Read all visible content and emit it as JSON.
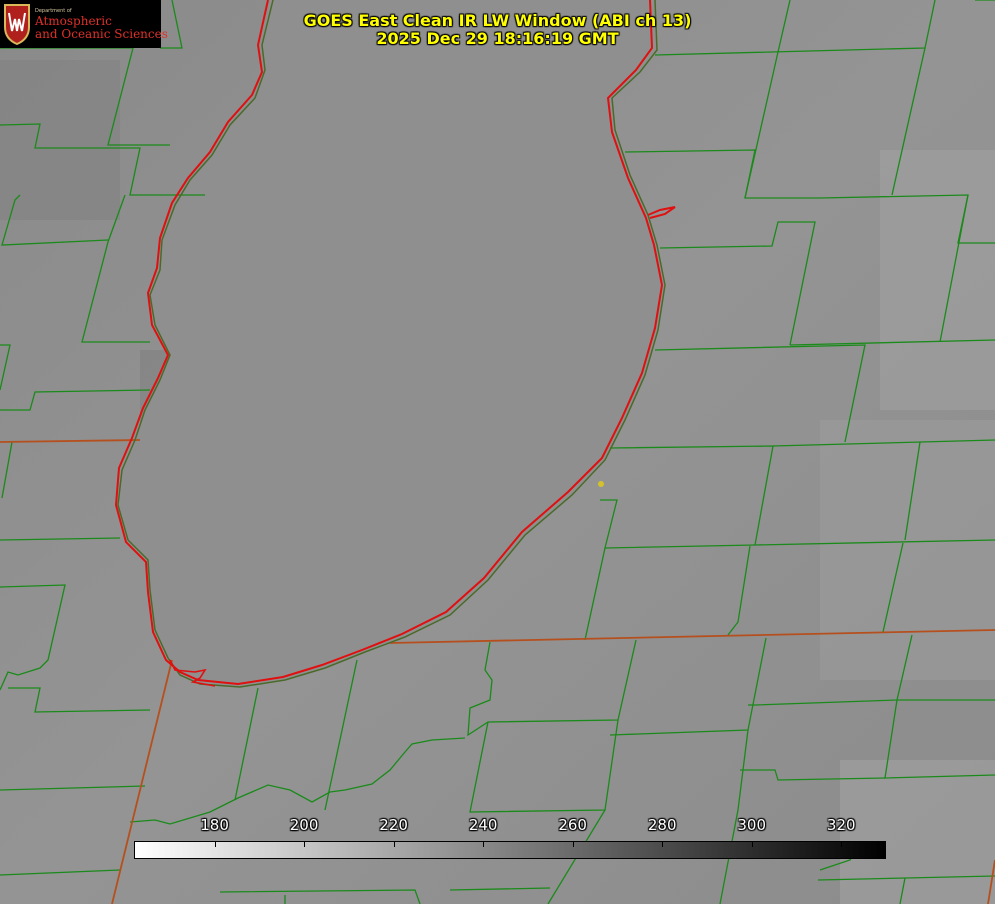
{
  "title": {
    "line1": "GOES East Clean IR LW Window (ABI ch 13)",
    "line2": "2025 Dec 29 18:16:19 GMT"
  },
  "logo": {
    "department": "Department of",
    "line1": "Atmospheric",
    "line2": "and Oceanic Sciences",
    "icon": "uw-crest-icon"
  },
  "colorbar": {
    "min": 162,
    "max": 330,
    "ticks": [
      "180",
      "200",
      "220",
      "240",
      "260",
      "280",
      "300",
      "320"
    ],
    "gradient": "white-to-black"
  },
  "colors": {
    "background": "#8e8e8e",
    "county_lines": "#1a8a1a",
    "state_lines": "#b5501e",
    "coastline": "#e01010",
    "title_text": "#ffff00",
    "marker": "#d4c22a"
  }
}
